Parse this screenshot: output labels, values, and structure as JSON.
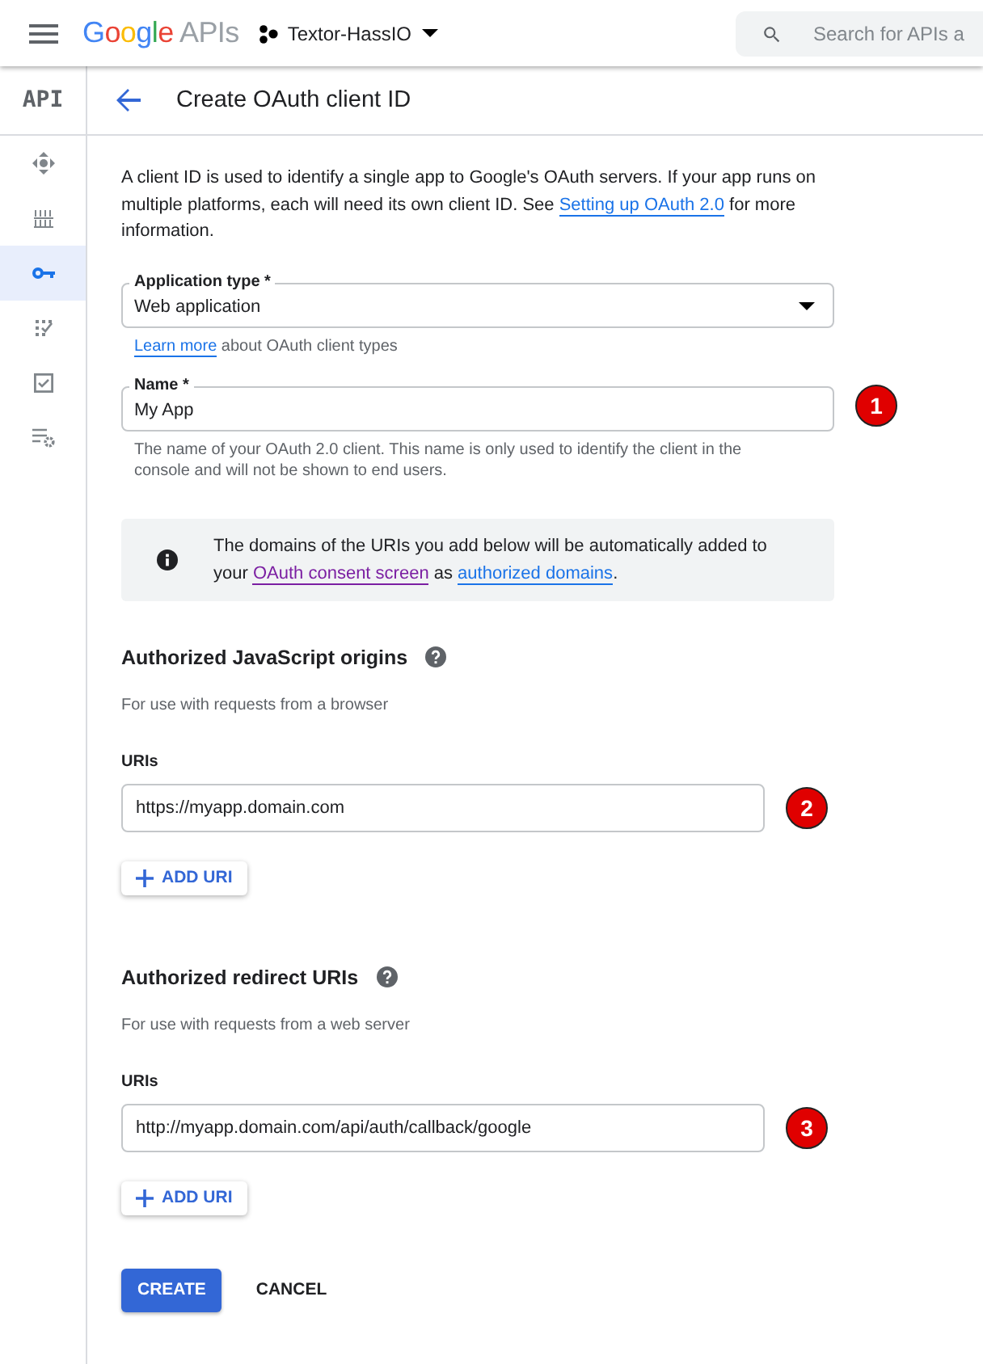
{
  "header": {
    "logo_word": "Google",
    "logo_suffix": "APIs",
    "project": "Textor-HassIO",
    "search": {
      "placeholder": "Search for APIs a"
    }
  },
  "sidebar": {
    "logo": "API",
    "items": [
      {
        "kind": "diamond",
        "selected": false
      },
      {
        "kind": "library",
        "selected": false
      },
      {
        "kind": "key",
        "selected": true
      },
      {
        "kind": "dots",
        "selected": false
      },
      {
        "kind": "check",
        "selected": false
      },
      {
        "kind": "settings",
        "selected": false
      }
    ]
  },
  "page": {
    "title": "Create OAuth client ID"
  },
  "intro": {
    "text": "A client ID is used to identify a single app to Google's OAuth servers. If your app runs on multiple platforms, each will need its own client ID. See ",
    "link": "Setting up OAuth 2.0",
    "after": " for more information."
  },
  "application_type": {
    "label": "Application type *",
    "value": "Web application",
    "help_link": "Learn more",
    "help_text": " about OAuth client types"
  },
  "name_field": {
    "label": "Name *",
    "value": "My App",
    "marker": "1",
    "help": "The name of your OAuth 2.0 client. This name is only used to identify the client in the console and will not be shown to end users."
  },
  "info": {
    "text": "The domains of the URIs you add below will be automatically added to your ",
    "link_1": "OAuth consent screen",
    "middle": " as ",
    "link_2": "authorized domains",
    "after": "."
  },
  "sections": [
    {
      "title": "Authorized JavaScript origins",
      "subtitle": "For use with requests from a browser",
      "label": "URIs",
      "value": "https://myapp.domain.com",
      "marker": "2",
      "add_button": "ADD URI"
    },
    {
      "title": "Authorized redirect URIs",
      "subtitle": "For use with requests from a web server",
      "label": "URIs",
      "value": "http://myapp.domain.com/api/auth/callback/google",
      "marker": "3",
      "add_button": "ADD URI"
    }
  ],
  "buttons": {
    "create": "CREATE",
    "cancel": "CANCEL"
  }
}
